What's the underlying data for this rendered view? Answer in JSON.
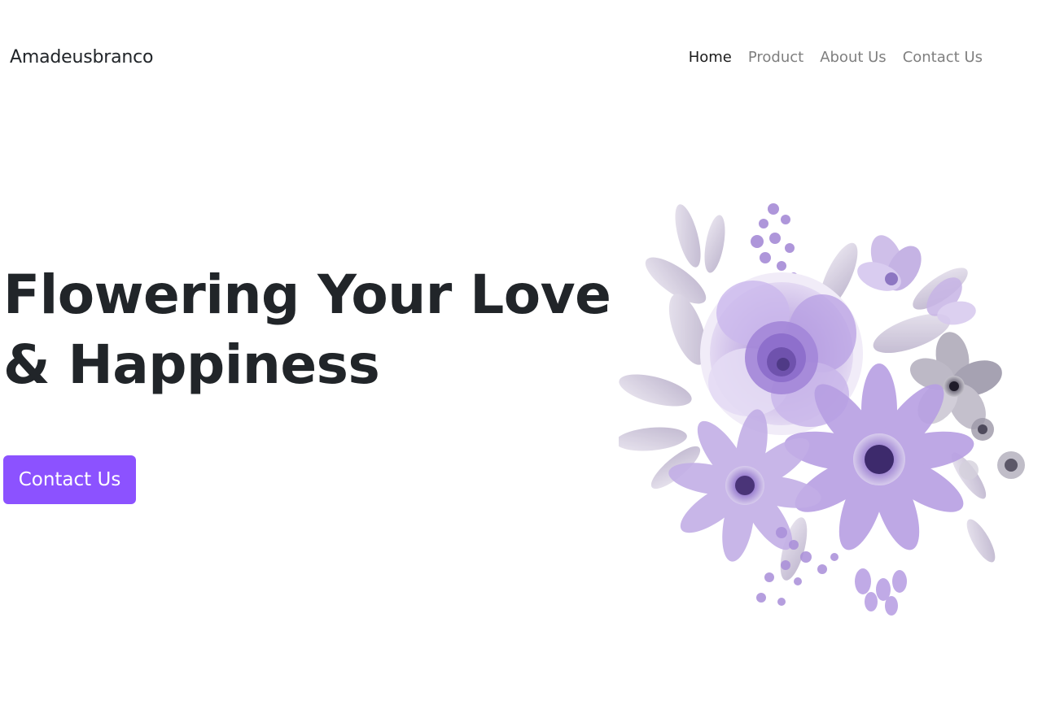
{
  "navbar": {
    "brand": "Amadeusbranco",
    "links": [
      {
        "label": "Home",
        "active": true
      },
      {
        "label": "Product",
        "active": false
      },
      {
        "label": "About Us",
        "active": false
      },
      {
        "label": "Contact Us",
        "active": false
      }
    ]
  },
  "hero": {
    "title_line1": "Flowering Your Love",
    "title_line2": "& Happiness",
    "cta_label": "Contact Us",
    "image_icon": "purple-flower-bouquet-illustration"
  },
  "colors": {
    "accent": "#8c52ff",
    "text_dark": "#212529",
    "nav_muted": "#7f7f7f"
  }
}
